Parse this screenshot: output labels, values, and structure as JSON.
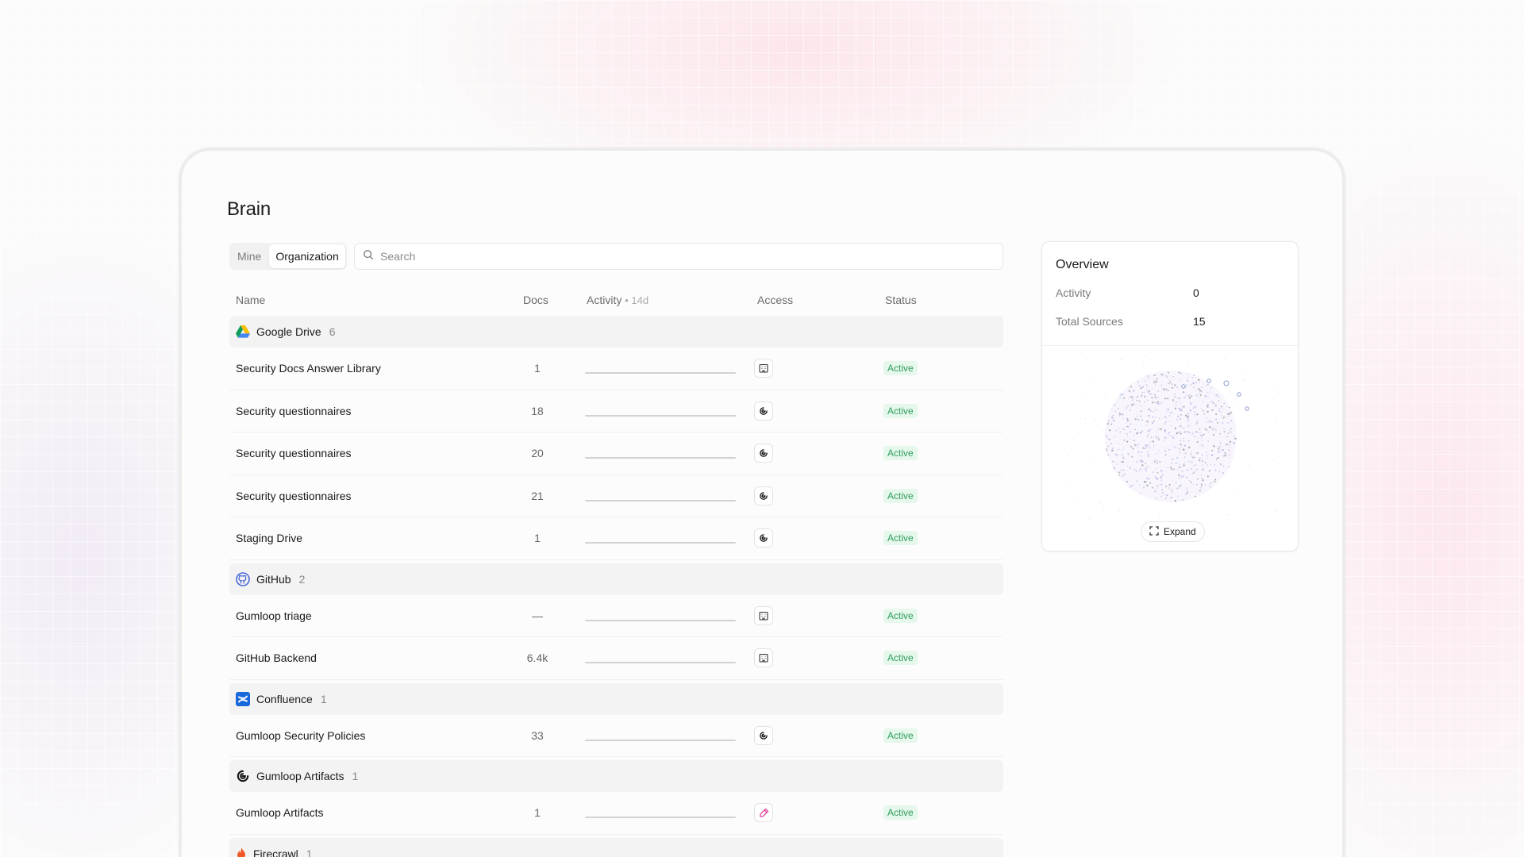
{
  "page": {
    "title": "Brain"
  },
  "filter": {
    "tabs": [
      {
        "label": "Mine",
        "active": false
      },
      {
        "label": "Organization",
        "active": true
      }
    ]
  },
  "search": {
    "placeholder": "Search"
  },
  "table": {
    "headers": {
      "name": "Name",
      "docs": "Docs",
      "activity": "Activity",
      "activity_suffix": "• 14d",
      "access": "Access",
      "status": "Status"
    },
    "groups": [
      {
        "name": "Google Drive",
        "count": "6",
        "icon": "google-drive-icon",
        "rows": [
          {
            "name": "Security Docs Answer Library",
            "docs": "1",
            "access": "organization-icon",
            "status": "Active"
          },
          {
            "name": "Security questionnaires",
            "docs": "18",
            "access": "gumloop-icon",
            "status": "Active"
          },
          {
            "name": "Security questionnaires",
            "docs": "20",
            "access": "gumloop-icon",
            "status": "Active"
          },
          {
            "name": "Security questionnaires",
            "docs": "21",
            "access": "gumloop-icon",
            "status": "Active"
          },
          {
            "name": "Staging Drive",
            "docs": "1",
            "access": "gumloop-icon",
            "status": "Active"
          }
        ]
      },
      {
        "name": "GitHub",
        "count": "2",
        "icon": "github-icon",
        "rows": [
          {
            "name": "Gumloop triage",
            "docs": "—",
            "access": "organization-icon",
            "status": "Active"
          },
          {
            "name": "GitHub Backend",
            "docs": "6.4k",
            "access": "organization-icon",
            "status": "Active"
          }
        ]
      },
      {
        "name": "Confluence",
        "count": "1",
        "icon": "confluence-icon",
        "rows": [
          {
            "name": "Gumloop Security Policies",
            "docs": "33",
            "access": "gumloop-icon",
            "status": "Active"
          }
        ]
      },
      {
        "name": "Gumloop Artifacts",
        "count": "1",
        "icon": "gumloop-icon",
        "rows": [
          {
            "name": "Gumloop Artifacts",
            "docs": "1",
            "access": "pen-icon",
            "status": "Active"
          }
        ]
      },
      {
        "name": "Firecrawl",
        "count": "1",
        "icon": "firecrawl-icon",
        "rows": []
      }
    ]
  },
  "overview": {
    "title": "Overview",
    "activity_label": "Activity",
    "activity_value": "0",
    "sources_label": "Total Sources",
    "sources_value": "15",
    "expand_label": "Expand"
  },
  "colors": {
    "status_bg": "#e6f7ec",
    "status_text": "#2f9e5a",
    "group_bg": "#f3f3f3",
    "pen_accent": "#e0449a"
  }
}
